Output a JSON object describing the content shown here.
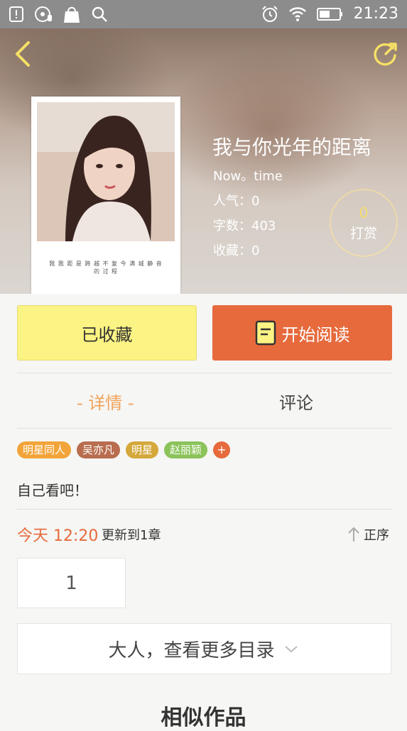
{
  "status_bar": {
    "time": "21:23",
    "left_icons": [
      "notification-icon",
      "music-icon",
      "shopping-bag-icon",
      "search-icon"
    ],
    "right_icons": [
      "alarm-icon",
      "wifi-icon",
      "battery-icon"
    ]
  },
  "header": {
    "back_icon": "chevron-left-icon",
    "share_icon": "share-icon"
  },
  "book": {
    "title": "我与你光年的距离",
    "author": "Now。time",
    "popularity": "人气：0",
    "word_count": "字数：403",
    "favorites": "收藏：0",
    "cover_caption": "我 我 距 是 跨 越 不 复 今 满 城 静 音 的 过 程"
  },
  "reward": {
    "count": "0",
    "label": "打赏"
  },
  "actions": {
    "favorite_label": "已收藏",
    "read_label": "开始阅读"
  },
  "tabs": {
    "details": "- 详情 -",
    "comments": "评论"
  },
  "tags": [
    {
      "label": "明星同人",
      "color": "#f2a43a"
    },
    {
      "label": "吴亦凡",
      "color": "#b86d4e"
    },
    {
      "label": "明星",
      "color": "#d4a83a"
    },
    {
      "label": "赵丽颖",
      "color": "#8bc35a"
    }
  ],
  "tag_add": "+",
  "description": "自己看吧！",
  "update": {
    "time": "今天 12:20",
    "text": "更新到1章",
    "sort_label": "正序"
  },
  "chapters": [
    "1"
  ],
  "more_catalog": "大人，查看更多目录",
  "similar_works": "相似作品",
  "colors": {
    "accent_orange": "#e66a3c",
    "accent_yellow": "#fbf383",
    "tab_active": "#f0a35a"
  }
}
